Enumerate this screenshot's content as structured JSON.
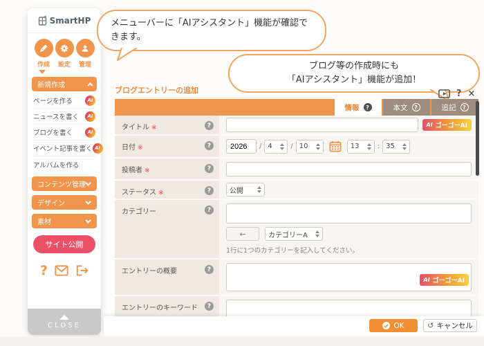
{
  "colors": {
    "accent": "#F0954B",
    "tab_inactive": "#9C8D7E",
    "publish": "#EA5167",
    "label_bg": "#EFE9E2",
    "ai_gradient_start": "#E8506B",
    "ai_gradient_end": "#FBD13A",
    "ok_button": "#F09033",
    "required": "#E04040"
  },
  "sidebar": {
    "logo_text": "SmartHP",
    "nav": [
      {
        "label": "作成"
      },
      {
        "label": "設定"
      },
      {
        "label": "管理"
      }
    ],
    "new_create_label": "新規作成",
    "menu": [
      {
        "label": "ページを作る"
      },
      {
        "label": "ニュースを書く"
      },
      {
        "label": "ブログを書く"
      },
      {
        "label": "イベント記事を書く"
      },
      {
        "label": "アルバムを作る"
      }
    ],
    "groups": [
      {
        "label": "コンテンツ管理"
      },
      {
        "label": "デザイン"
      },
      {
        "label": "素材"
      }
    ],
    "publish_label": "サイト公開",
    "help_glyph": "?",
    "close_label": "CLOSE",
    "ai_badge_text": "AI"
  },
  "callouts": {
    "first": "メニューバーに「AIアシスタント」機能が確認できます。",
    "second_line1": "ブログ等の作成時にも",
    "second_line2": "「AIアシスタント」機能が追加！"
  },
  "form": {
    "title": "ブログエントリーの追加",
    "window_icons": {
      "help": "?",
      "close": "×"
    },
    "help_glyph": "?",
    "required_mark": "※",
    "tabs": [
      {
        "label": "情報"
      },
      {
        "label": "本文"
      },
      {
        "label": "追記"
      }
    ],
    "fields": {
      "title": {
        "label": "タイトル"
      },
      "date": {
        "label": "日付",
        "year": "2026",
        "month": "4",
        "day": "10",
        "hour": "13",
        "minute": "35",
        "slash": "/",
        "colon": ":"
      },
      "author": {
        "label": "投稿者"
      },
      "status": {
        "label": "ステータス",
        "value": "公開"
      },
      "category": {
        "label": "カテゴリー",
        "move_button": "←",
        "select_value": "カテゴリーA",
        "hint": "1行に1つのカテゴリーを記入してください。"
      },
      "summary": {
        "label": "エントリーの概要"
      },
      "keywords": {
        "label": "エントリーのキーワード"
      }
    },
    "ai_button": {
      "badge": "AI",
      "label": "ゴーゴーAI"
    },
    "footer": {
      "ok": "OK",
      "cancel": "キャンセル",
      "undo_glyph": "↺"
    }
  }
}
